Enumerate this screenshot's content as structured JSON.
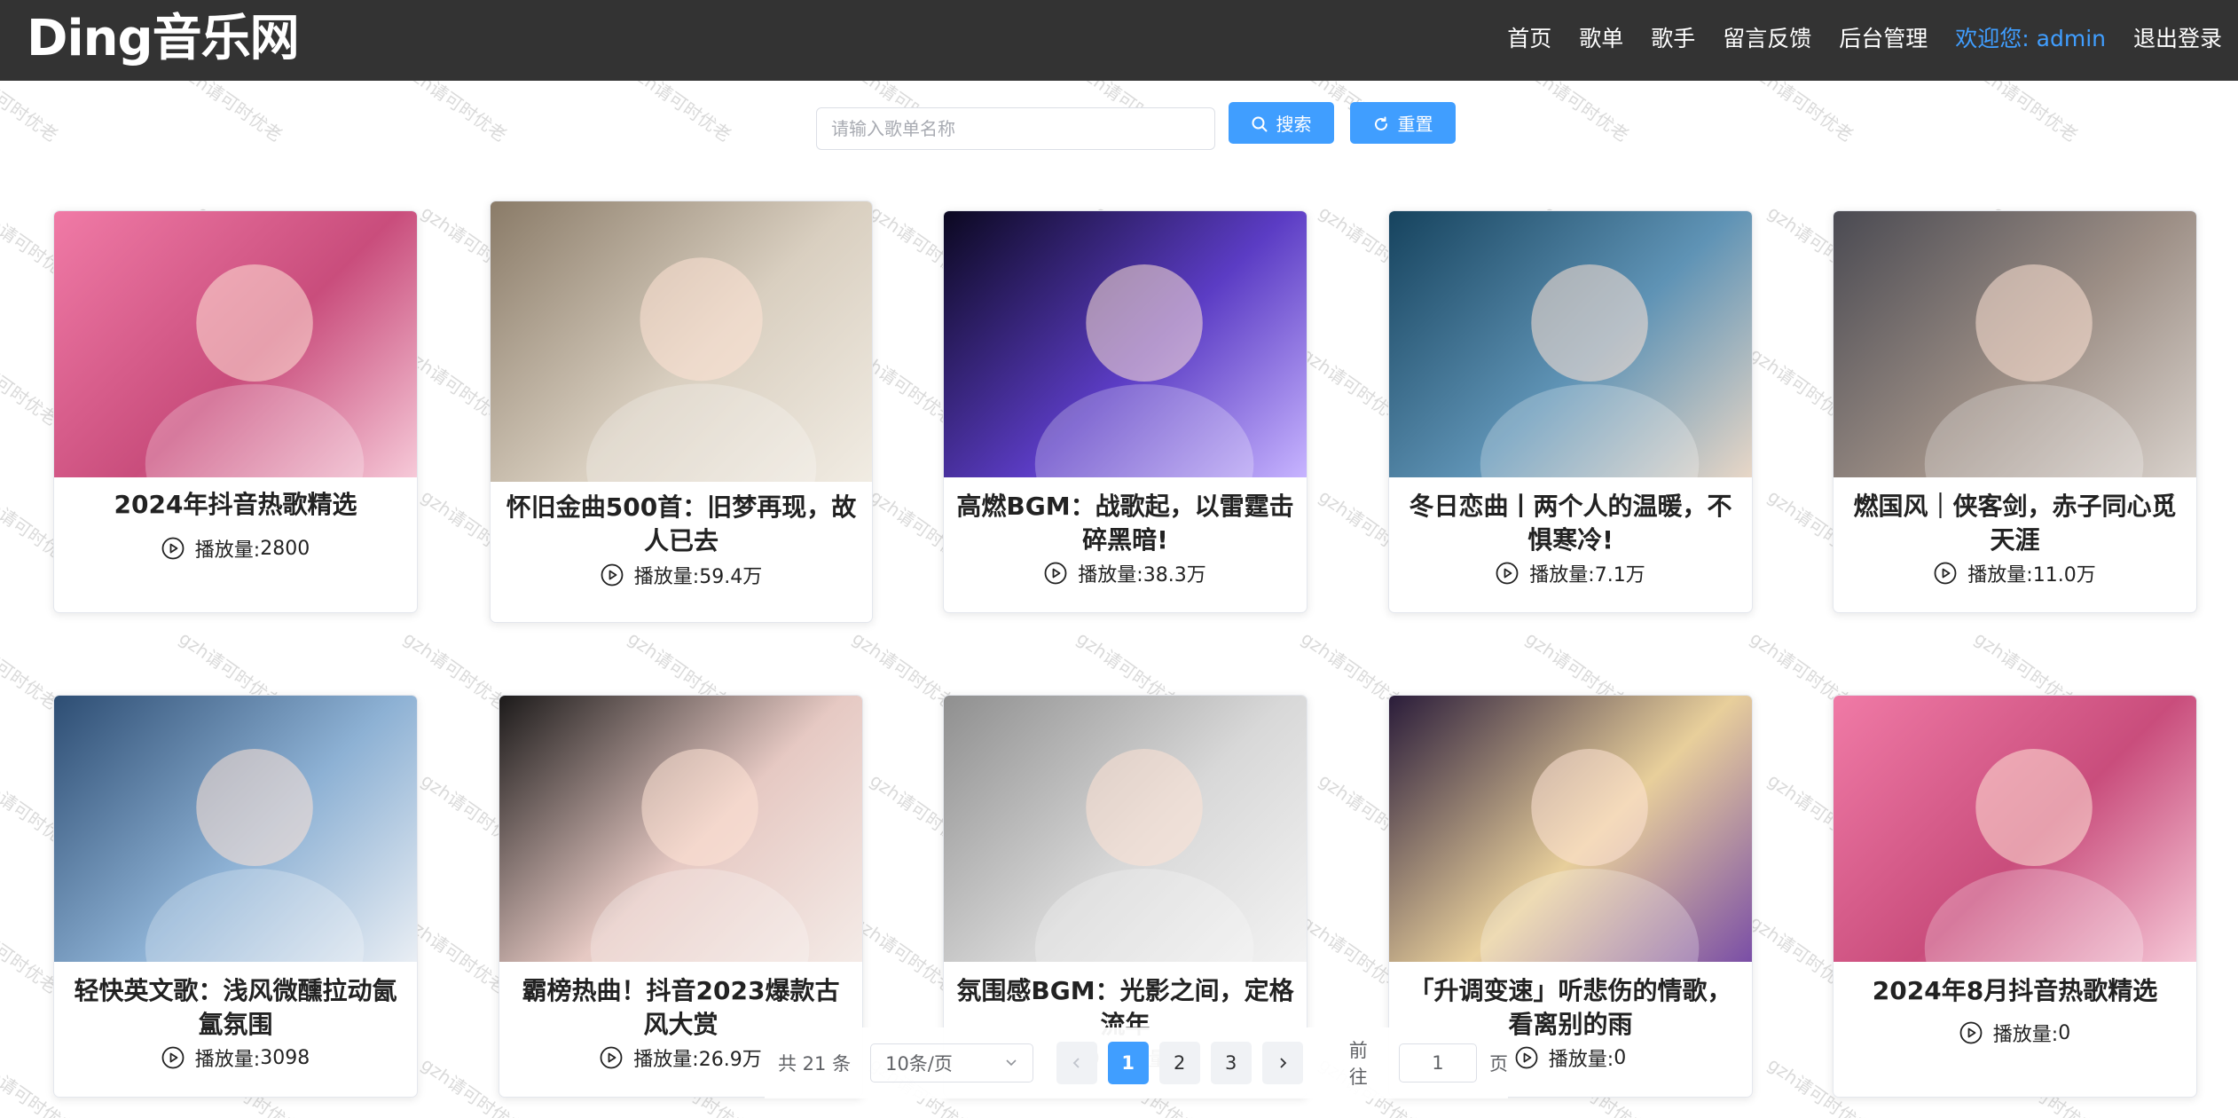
{
  "header": {
    "logo": "Ding音乐网",
    "nav": [
      "首页",
      "歌单",
      "歌手",
      "留言反馈",
      "后台管理"
    ],
    "welcome": "欢迎您: admin",
    "logout": "退出登录"
  },
  "search": {
    "placeholder": "请输入歌单名称",
    "search_label": "搜索",
    "reset_label": "重置"
  },
  "plays_prefix": "播放量: ",
  "playlists": [
    {
      "title": "2024年抖音热歌精选",
      "plays": "2800"
    },
    {
      "title": "怀旧金曲500首：旧梦再现，故人已去",
      "plays": "59.4万"
    },
    {
      "title": "高燃BGM：战歌起，以雷霆击碎黑暗!",
      "plays": "38.3万"
    },
    {
      "title": "冬日恋曲丨两个人的温暖，不惧寒冷!",
      "plays": "7.1万"
    },
    {
      "title": "燃国风｜侠客剑，赤子同心觅天涯",
      "plays": "11.0万"
    },
    {
      "title": "轻快英文歌：浅风微醺拉动氤氲氛围",
      "plays": "3098"
    },
    {
      "title": "霸榜热曲！抖音2023爆款古风大赏",
      "plays": "26.9万"
    },
    {
      "title": "氛围感BGM：光影之间，定格流年",
      "plays": ""
    },
    {
      "title": "「升调变速」听悲伤的情歌，看离别的雨",
      "plays": "0"
    },
    {
      "title": "2024年8月抖音热歌精选",
      "plays": "0"
    }
  ],
  "pagination": {
    "total": "共 21 条",
    "page_size": "10条/页",
    "pages": [
      "1",
      "2",
      "3"
    ],
    "current": "1",
    "jump_label": "前往",
    "jump_value": "1",
    "page_unit": "页"
  },
  "watermark": "gzh请可时优老",
  "colors": {
    "header_bg": "#333333",
    "accent": "#409eff"
  }
}
